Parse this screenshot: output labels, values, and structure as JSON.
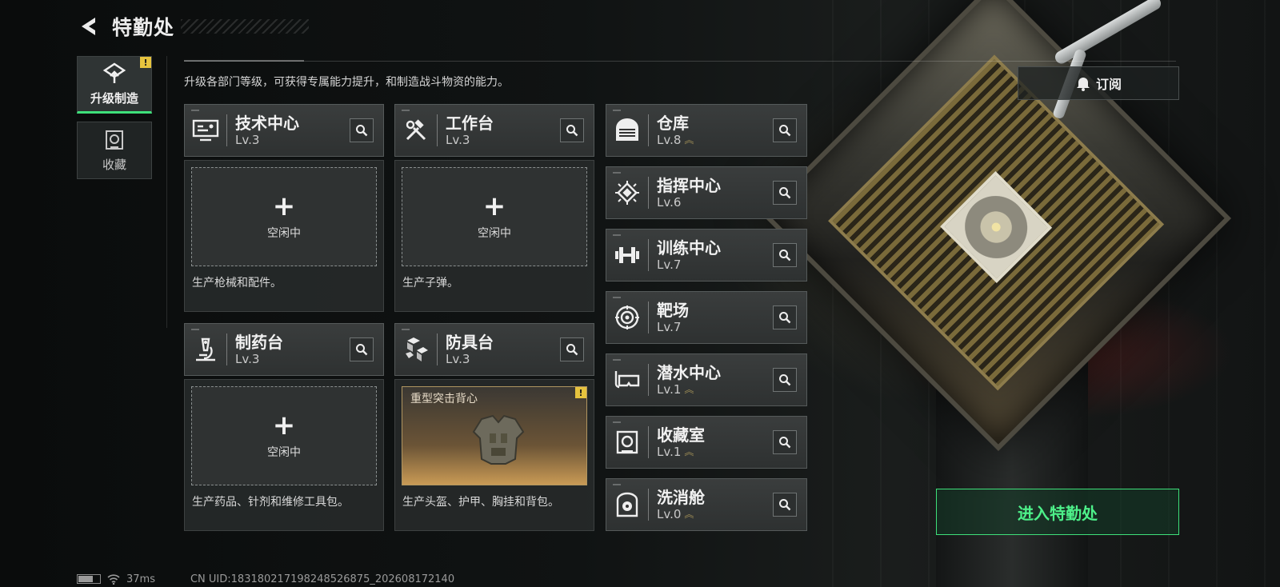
{
  "header": {
    "title": "特勤处"
  },
  "sidebar": {
    "tabs": [
      {
        "label": "升级制造",
        "active": true,
        "badge": "!"
      },
      {
        "label": "收藏",
        "active": false
      }
    ]
  },
  "description": "升级各部门等级，可获得专属能力提升，和制造战斗物资的能力。",
  "subscribe": {
    "label": "订阅"
  },
  "production_departments": [
    {
      "name": "技术中心",
      "level": "Lv.3",
      "icon": "monitor-icon",
      "slot_status": "空闲中",
      "slot_plus": "+",
      "desc": "生产枪械和配件。"
    },
    {
      "name": "工作台",
      "level": "Lv.3",
      "icon": "hammer-wrench-icon",
      "slot_status": "空闲中",
      "slot_plus": "+",
      "desc": "生产子弹。"
    },
    {
      "name": "制药台",
      "level": "Lv.3",
      "icon": "microscope-icon",
      "slot_status": "空闲中",
      "slot_plus": "+",
      "desc": "生产药品、针剂和维修工具包。"
    },
    {
      "name": "防具台",
      "level": "Lv.3",
      "icon": "cubes-icon",
      "slot_item": "重型突击背心",
      "slot_badge": "!",
      "desc": "生产头盔、护甲、胸挂和背包。"
    }
  ],
  "other_departments": [
    {
      "name": "仓库",
      "level": "Lv.8",
      "upgradable": true,
      "icon": "warehouse-icon"
    },
    {
      "name": "指挥中心",
      "level": "Lv.6",
      "upgradable": false,
      "icon": "chip-icon"
    },
    {
      "name": "训练中心",
      "level": "Lv.7",
      "upgradable": false,
      "icon": "dumbbell-icon"
    },
    {
      "name": "靶场",
      "level": "Lv.7",
      "upgradable": false,
      "icon": "target-icon"
    },
    {
      "name": "潜水中心",
      "level": "Lv.1",
      "upgradable": true,
      "icon": "diving-mask-icon"
    },
    {
      "name": "收藏室",
      "level": "Lv.1",
      "upgradable": true,
      "icon": "collection-icon"
    },
    {
      "name": "洗消舱",
      "level": "Lv.0",
      "upgradable": true,
      "icon": "radiation-door-icon"
    }
  ],
  "enter_button": {
    "label": "进入特勤处"
  },
  "footer": {
    "ping": "37ms",
    "uid": "CN UID:183180217198248526875_202608172140"
  },
  "colors": {
    "accent_green": "#3ee07a",
    "warning_yellow": "#e6c33e",
    "upgrade_gold": "#9d8c55"
  }
}
